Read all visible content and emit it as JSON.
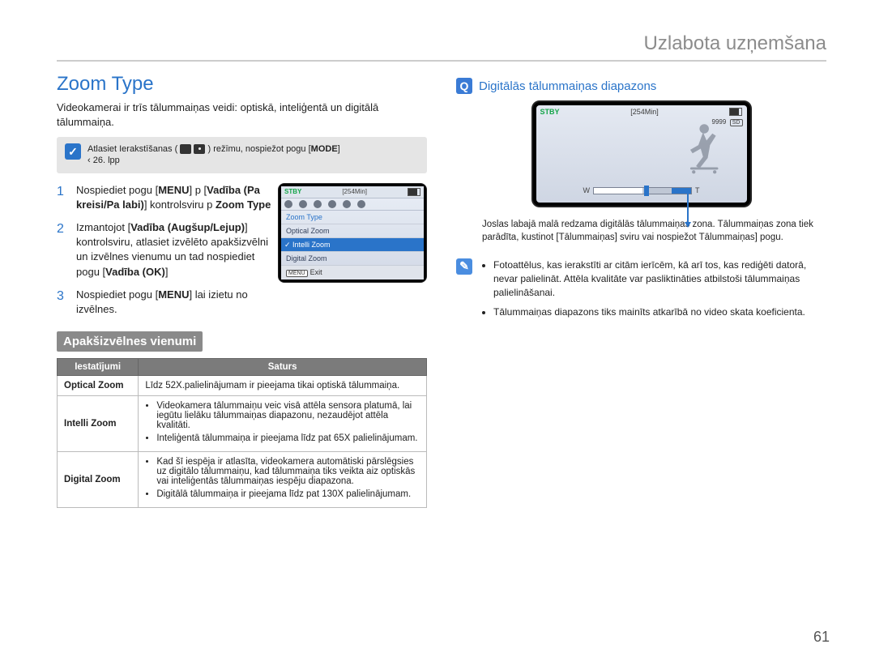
{
  "chapter": "Uzlabota uzņemšana",
  "title": "Zoom Type",
  "intro": "Videokamerai ir trīs tālummaiņas veidi: optiskā, inteliģentā un digitālā tālummaiņa.",
  "mode_box": {
    "pre": "Atlasiet Ierakstīšanas (",
    "post": ") režīmu, nospiežot pogu [",
    "mode_label": "MODE",
    "tail": "]",
    "ref": "‹ 26. lpp"
  },
  "steps": [
    {
      "n": "1",
      "pre": "Nospiediet pogu [",
      "b1": "MENU",
      "mid": "] p [",
      "b2": "Vadība (Pa kreisi/Pa labi)",
      "mid2": "] kontrolsviru  p ",
      "b3": "Zoom Type",
      "post": ""
    },
    {
      "n": "2",
      "pre": "Izmantojot [",
      "b1": "Vadība (Augšup/Lejup)",
      "mid": "] kontrolsviru, atlasiet izvēlēto apakšizvēlni un izvēlnes vienumu un tad nospiediet pogu [",
      "b2": "Vadība (OK)",
      "post": "] "
    },
    {
      "n": "3",
      "pre": "Nospiediet pogu [",
      "b1": "MENU",
      "post": "] lai izietu no izvēlnes."
    }
  ],
  "menu_shot": {
    "stby": "STBY",
    "time": "[254Min]",
    "items": [
      "Zoom Type",
      "Optical Zoom",
      "Intelli Zoom",
      "Digital Zoom"
    ],
    "selected": "Intelli Zoom",
    "exit_prefix": "MENU",
    "exit": "Exit"
  },
  "subhead": "Apakšizvēlnes vienumi",
  "table": {
    "headers": [
      "Iestatījumi",
      "Saturs"
    ],
    "rows": [
      {
        "name": "Optical Zoom",
        "content": "Līdz 52X.palielinājumam ir pieejama tikai optiskā tālummaiņa."
      },
      {
        "name": "Intelli Zoom",
        "content": [
          "Videokamera tālummaiņu veic visā attēla sensora platumā, lai iegūtu lielāku tālummaiņas diapazonu, nezaudējot attēla kvalitāti.",
          "Inteliģentā tālummaiņa ir pieejama līdz pat 65X palielinājumam."
        ]
      },
      {
        "name": "Digital Zoom",
        "content": [
          "Kad šī iespēja ir atlasīta, videokamera automātiski pārslēgsies uz digitālo tālummaiņu, kad tālummaiņa tiks veikta aiz optiskās vai inteliģentās tālummaiņas iespēju diapazona.",
          "Digitālā tālummaiņa ir pieejama līdz pat 130X palielinājumam."
        ]
      }
    ]
  },
  "right": {
    "heading": "Digitālās tālummaiņas diapazons",
    "camera": {
      "stby": "STBY",
      "time": "[254Min]",
      "count": "9999",
      "w": "W",
      "t": "T"
    },
    "below": "Joslas labajā malā redzama digitālās tālummaiņas zona. Tālummaiņas zona tiek parādīta, kustinot [Tālummaiņas] sviru vai nospiežot Tālummaiņas] pogu.",
    "note_items": [
      "Fotoattēlus, kas ierakstīti ar citām ierīcēm, kā arī tos, kas rediģēti datorā, nevar palielināt. Attēla kvalitāte var pasliktināties atbilstoši tālummaiņas palielināšanai.",
      "Tālummaiņas diapazons tiks mainīts atkarībā no video skata koeficienta."
    ]
  },
  "pagenum": "61"
}
